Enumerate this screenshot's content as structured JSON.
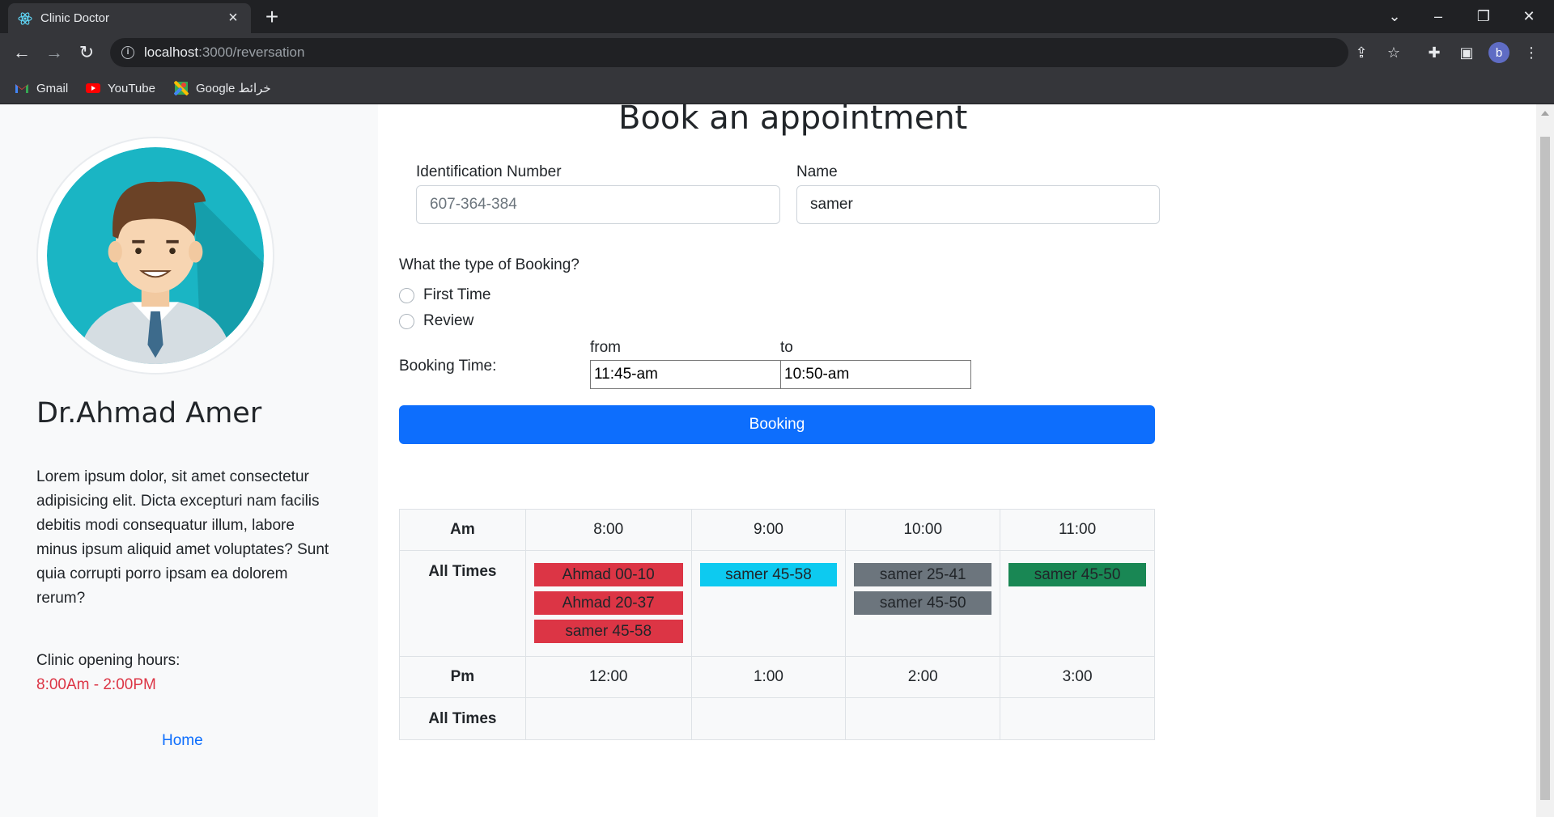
{
  "browser": {
    "tab_title": "Clinic Doctor",
    "url_host": "localhost",
    "url_path": ":3000/reversation",
    "profile_initial": "b",
    "bookmarks": [
      {
        "label": "Gmail",
        "icon": "gmail-icon"
      },
      {
        "label": "YouTube",
        "icon": "youtube-icon"
      },
      {
        "label": "Google خرائط",
        "icon": "google-maps-icon"
      }
    ]
  },
  "sidebar": {
    "doctor_name": "Dr.Ahmad Amer",
    "description": "Lorem ipsum dolor, sit amet consectetur adipisicing elit. Dicta excepturi nam facilis debitis modi consequatur illum, labore minus ipsum aliquid amet voluptates? Sunt quia corrupti porro ipsam ea dolorem rerum?",
    "hours_label": "Clinic opening hours:",
    "hours_value": "8:00Am - 2:00PM",
    "home_link": "Home"
  },
  "form": {
    "title": "Book an appointment",
    "id_label": "Identification Number",
    "id_placeholder": "607-364-384",
    "name_label": "Name",
    "name_value": "samer",
    "booking_type_question": "What the type of Booking?",
    "options": [
      "First Time",
      "Review"
    ],
    "booking_time_label": "Booking Time:",
    "from_label": "from",
    "to_label": "to",
    "from_value": "11:45-am",
    "to_value": "10:50-am",
    "submit_label": "Booking"
  },
  "schedule": {
    "am_label": "Am",
    "pm_label": "Pm",
    "all_times_label": "All Times",
    "am_hours": [
      "8:00",
      "9:00",
      "10:00",
      "11:00"
    ],
    "pm_hours": [
      "12:00",
      "1:00",
      "2:00",
      "3:00"
    ],
    "am_slots": [
      [
        {
          "text": "Ahmad 00-10",
          "color": "#dc3545"
        },
        {
          "text": "Ahmad 20-37",
          "color": "#dc3545"
        },
        {
          "text": "samer 45-58",
          "color": "#dc3545"
        }
      ],
      [
        {
          "text": "samer 45-58",
          "color": "#0dcaf0"
        }
      ],
      [
        {
          "text": "samer 25-41",
          "color": "#6c757d"
        },
        {
          "text": "samer 45-50",
          "color": "#6c757d"
        }
      ],
      [
        {
          "text": "samer 45-50",
          "color": "#198754"
        }
      ]
    ]
  }
}
